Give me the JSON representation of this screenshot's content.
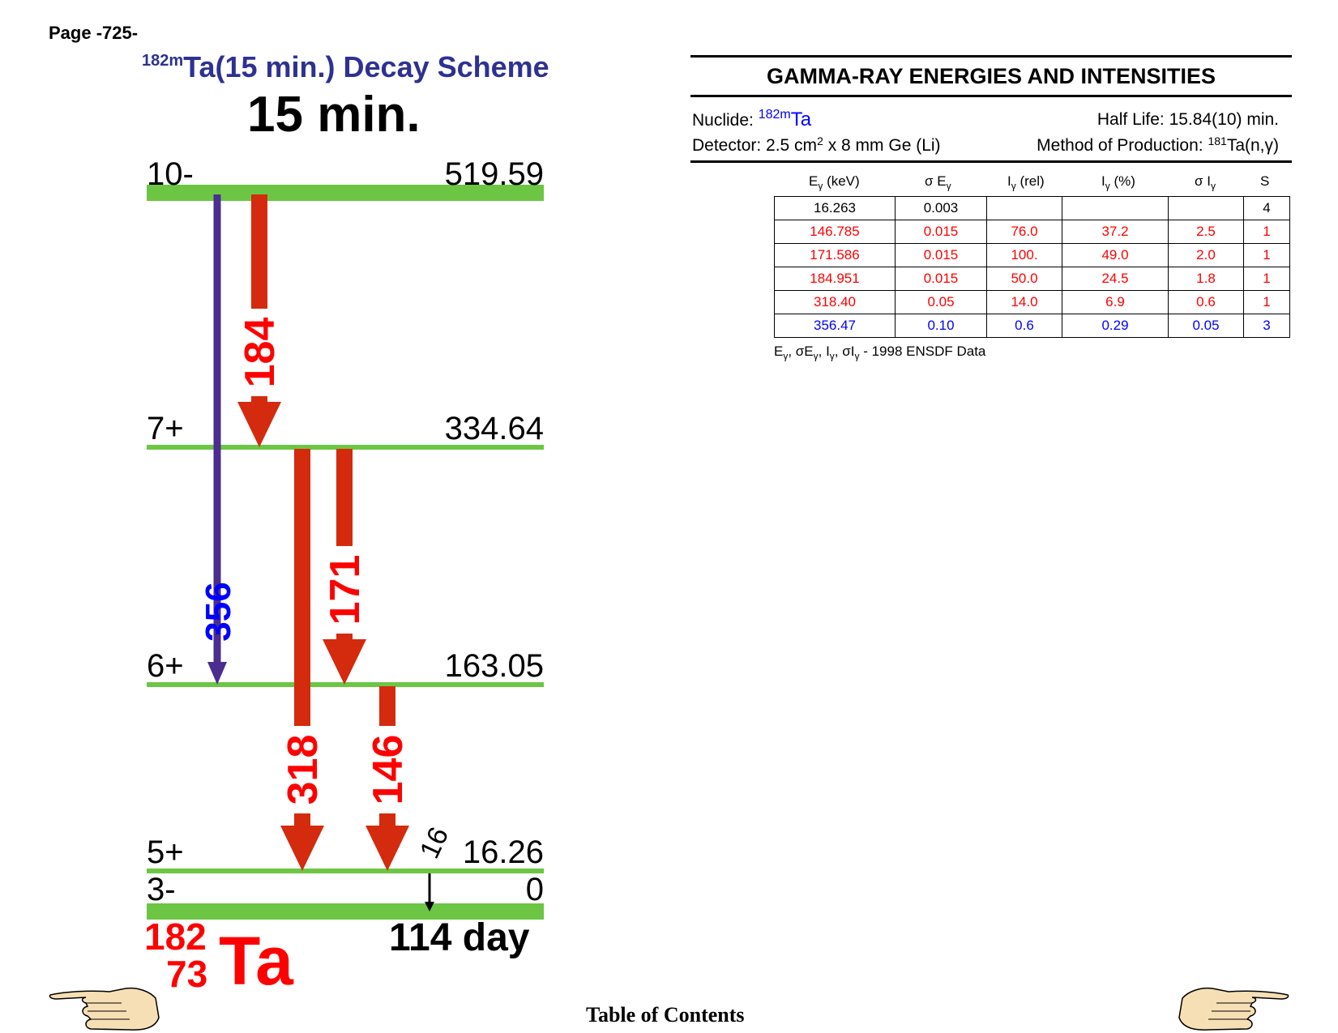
{
  "page_label": "Page -725-",
  "scheme_title": {
    "mass": "182m",
    "rest": "Ta(15 min.) Decay Scheme"
  },
  "parent_halflife": "15 min.",
  "levels": [
    {
      "spin": "10-",
      "energy_label": "519.59",
      "energy": 519.59,
      "thick": true
    },
    {
      "spin": "7+",
      "energy_label": "334.64",
      "energy": 334.64,
      "thick": false
    },
    {
      "spin": "6+",
      "energy_label": "163.05",
      "energy": 163.05,
      "thick": false
    },
    {
      "spin": "5+",
      "energy_label": "16.26",
      "energy": 16.26,
      "thick": false
    },
    {
      "spin": "3-",
      "energy_label": "0",
      "energy": 0,
      "thick": true
    }
  ],
  "transitions": [
    {
      "label": "356",
      "from": 0,
      "to": 2,
      "color": "#4b2c8f",
      "label_color": "#0000ff",
      "kind": "thin"
    },
    {
      "label": "184",
      "from": 0,
      "to": 1,
      "color": "#d42a0e",
      "label_color": "#ff0000",
      "kind": "thick"
    },
    {
      "label": "318",
      "from": 1,
      "to": 3,
      "color": "#d42a0e",
      "label_color": "#ff0000",
      "kind": "thick"
    },
    {
      "label": "171",
      "from": 1,
      "to": 2,
      "color": "#d42a0e",
      "label_color": "#ff0000",
      "kind": "thick"
    },
    {
      "label": "146",
      "from": 2,
      "to": 3,
      "color": "#d42a0e",
      "label_color": "#ff0000",
      "kind": "thick"
    },
    {
      "label": "16",
      "from": 3,
      "to": 4,
      "color": "#000000",
      "label_color": "#000000",
      "kind": "tiny"
    }
  ],
  "ground_halflife": "114 day",
  "daughter": {
    "mass": "182",
    "z": "73",
    "symbol": "Ta"
  },
  "table": {
    "title": "GAMMA-RAY ENERGIES AND INTENSITIES",
    "nuclide_label": "Nuclide:",
    "nuclide_mass": "182m",
    "nuclide_symbol": "Ta",
    "half_life": "Half Life: 15.84(10) min.",
    "detector_pre": "Detector: 2.5 cm",
    "detector_sup": "2",
    "detector_post": " x 8 mm Ge (Li)",
    "method_pre": "Method of Production: ",
    "method_sup": "181",
    "method_post": "Ta(n,γ)",
    "headers": [
      "E",
      "γ",
      " (keV)",
      "σ E",
      "γ",
      "I",
      "γ",
      " (rel)",
      "I",
      "γ",
      " (%)",
      "σ I",
      "γ",
      "S"
    ],
    "rows": [
      {
        "color": "#000000",
        "cells": [
          "16.263",
          "0.003",
          "",
          "",
          "",
          "4"
        ]
      },
      {
        "color": "#ff0000",
        "cells": [
          "146.785",
          "0.015",
          "76.0",
          "37.2",
          "2.5",
          "1"
        ]
      },
      {
        "color": "#ff0000",
        "cells": [
          "171.586",
          "0.015",
          "100.",
          "49.0",
          "2.0",
          "1"
        ]
      },
      {
        "color": "#ff0000",
        "cells": [
          "184.951",
          "0.015",
          "50.0",
          "24.5",
          "1.8",
          "1"
        ]
      },
      {
        "color": "#ff0000",
        "cells": [
          "318.40",
          "0.05",
          "14.0",
          "6.9",
          "0.6",
          "1"
        ]
      },
      {
        "color": "#0000ff",
        "cells": [
          "356.47",
          "0.10",
          "0.6",
          "0.29",
          "0.05",
          "3"
        ]
      }
    ],
    "footnote_source": "1998 ENSDF Data"
  },
  "toc_label": "Table of Contents",
  "colors": {
    "level": "#6cc644",
    "title_blue": "#2e3192",
    "hand_skin": "#f7dfb5"
  }
}
